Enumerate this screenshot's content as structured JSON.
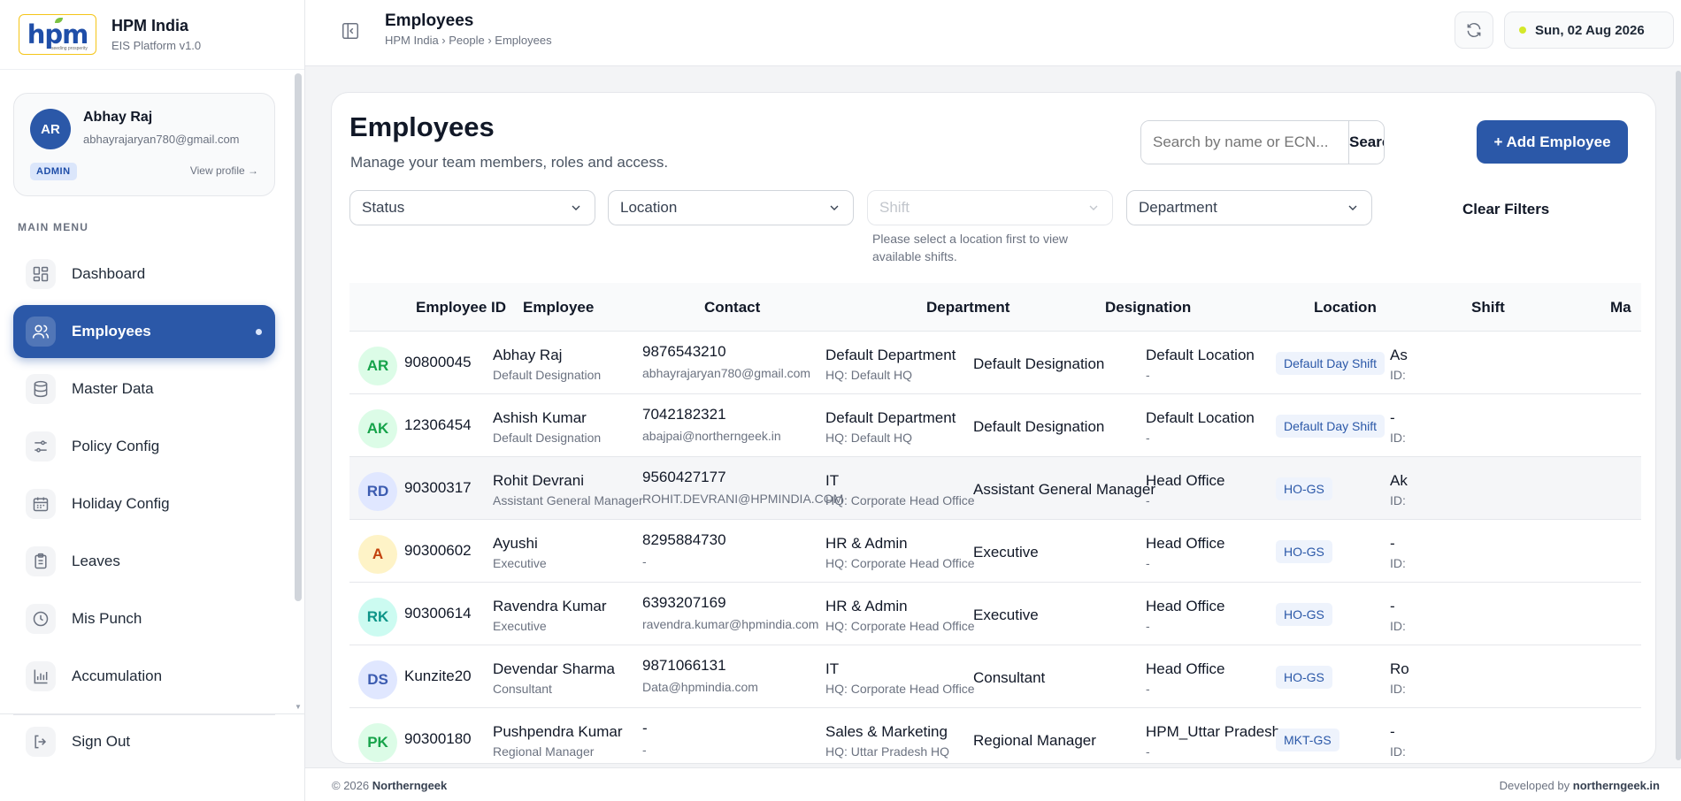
{
  "brand": {
    "logo_text": "hpm",
    "logo_tagline": "seeding prosperity",
    "name": "HPM India",
    "subtitle": "EIS Platform v1.0"
  },
  "profile": {
    "initials": "AR",
    "name": "Abhay Raj",
    "email": "abhayrajaryan780@gmail.com",
    "role": "ADMIN",
    "link": "View profile →"
  },
  "menu": {
    "heading": "MAIN MENU",
    "items": [
      {
        "label": "Dashboard",
        "icon": "dashboard-icon"
      },
      {
        "label": "Employees",
        "icon": "users-icon",
        "active": true
      },
      {
        "label": "Master Data",
        "icon": "database-icon"
      },
      {
        "label": "Policy Config",
        "icon": "sliders-icon"
      },
      {
        "label": "Holiday Config",
        "icon": "calendar-icon"
      },
      {
        "label": "Leaves",
        "icon": "clipboard-icon"
      },
      {
        "label": "Mis Punch",
        "icon": "clock-icon"
      },
      {
        "label": "Accumulation",
        "icon": "bar-chart-icon"
      }
    ],
    "signout": "Sign Out"
  },
  "header": {
    "title": "Employees",
    "breadcrumb": "HPM India › People › Employees",
    "date": "Sun, 02 Aug 2026"
  },
  "page": {
    "title": "Employees",
    "subtitle": "Manage your team members, roles and access.",
    "search_placeholder": "Search by name or ECN...",
    "search_button": "Search",
    "add_button": "+ Add Employee",
    "filters": {
      "status": "Status",
      "location": "Location",
      "shift": "Shift",
      "department": "Department"
    },
    "shift_hint": "Please select a location first to view available shifts.",
    "clear_filters": "Clear Filters"
  },
  "table": {
    "columns": [
      "Employee ID",
      "Employee",
      "Contact",
      "Department",
      "Designation",
      "Location",
      "Shift",
      "Ma"
    ],
    "rows": [
      {
        "initials": "AR",
        "avatar_bg": "#dcfce7",
        "avatar_fg": "#16a34a",
        "id": "90800045",
        "name": "Abhay Raj",
        "title": "Default Designation",
        "phone": "9876543210",
        "email": "abhayrajaryan780@gmail.com",
        "dept": "Default Department",
        "hq": "HQ: Default HQ",
        "designation": "Default Designation",
        "location": "Default Location",
        "loc_sub": "-",
        "shift": "Default Day Shift",
        "mgr": "As",
        "mgr_id": "ID:"
      },
      {
        "initials": "AK",
        "avatar_bg": "#dcfce7",
        "avatar_fg": "#16a34a",
        "id": "12306454",
        "name": "Ashish Kumar",
        "title": "Default Designation",
        "phone": "7042182321",
        "email": "abajpai@northerngeek.in",
        "dept": "Default Department",
        "hq": "HQ: Default HQ",
        "designation": "Default Designation",
        "location": "Default Location",
        "loc_sub": "-",
        "shift": "Default Day Shift",
        "mgr": "-",
        "mgr_id": "ID:"
      },
      {
        "initials": "RD",
        "avatar_bg": "#e0e7ff",
        "avatar_fg": "#3b5bb0",
        "id": "90300317",
        "name": "Rohit Devrani",
        "title": "Assistant General Manager",
        "phone": "9560427177",
        "email": "ROHIT.DEVRANI@HPMINDIA.COM",
        "dept": "IT",
        "hq": "HQ: Corporate Head Office",
        "designation": "Assistant General Manager",
        "location": "Head Office",
        "loc_sub": "-",
        "shift": "HO-GS",
        "mgr": "Ak",
        "mgr_id": "ID:"
      },
      {
        "initials": "A",
        "avatar_bg": "#fef3c7",
        "avatar_fg": "#c2410c",
        "id": "90300602",
        "name": "Ayushi",
        "title": "Executive",
        "phone": "8295884730",
        "email": "-",
        "dept": "HR & Admin",
        "hq": "HQ: Corporate Head Office",
        "designation": "Executive",
        "location": "Head Office",
        "loc_sub": "-",
        "shift": "HO-GS",
        "mgr": "-",
        "mgr_id": "ID:"
      },
      {
        "initials": "RK",
        "avatar_bg": "#ccfbf1",
        "avatar_fg": "#0d9488",
        "id": "90300614",
        "name": "Ravendra Kumar",
        "title": "Executive",
        "phone": "6393207169",
        "email": "ravendra.kumar@hpmindia.com",
        "dept": "HR & Admin",
        "hq": "HQ: Corporate Head Office",
        "designation": "Executive",
        "location": "Head Office",
        "loc_sub": "-",
        "shift": "HO-GS",
        "mgr": "-",
        "mgr_id": "ID:"
      },
      {
        "initials": "DS",
        "avatar_bg": "#e0e7ff",
        "avatar_fg": "#3b5bb0",
        "id": "Kunzite20",
        "name": "Devendar Sharma",
        "title": "Consultant",
        "phone": "9871066131",
        "email": "Data@hpmindia.com",
        "dept": "IT",
        "hq": "HQ: Corporate Head Office",
        "designation": "Consultant",
        "location": "Head Office",
        "loc_sub": "-",
        "shift": "HO-GS",
        "mgr": "Ro",
        "mgr_id": "ID:"
      },
      {
        "initials": "PK",
        "avatar_bg": "#dcfce7",
        "avatar_fg": "#16a34a",
        "id": "90300180",
        "name": "Pushpendra Kumar",
        "title": "Regional Manager",
        "phone": "-",
        "email": "-",
        "dept": "Sales & Marketing",
        "hq": "HQ: Uttar Pradesh HQ",
        "designation": "Regional Manager",
        "location": "HPM_Uttar Pradesh",
        "loc_sub": "-",
        "shift": "MKT-GS",
        "mgr": "-",
        "mgr_id": "ID:"
      }
    ]
  },
  "footer": {
    "copyright": "© 2026",
    "company": "Northerngeek",
    "dev_prefix": "Developed by",
    "dev_name": "northerngeek.in"
  },
  "colors": {
    "accent": "#2b58a8",
    "status_dot": "#d4e82a"
  }
}
